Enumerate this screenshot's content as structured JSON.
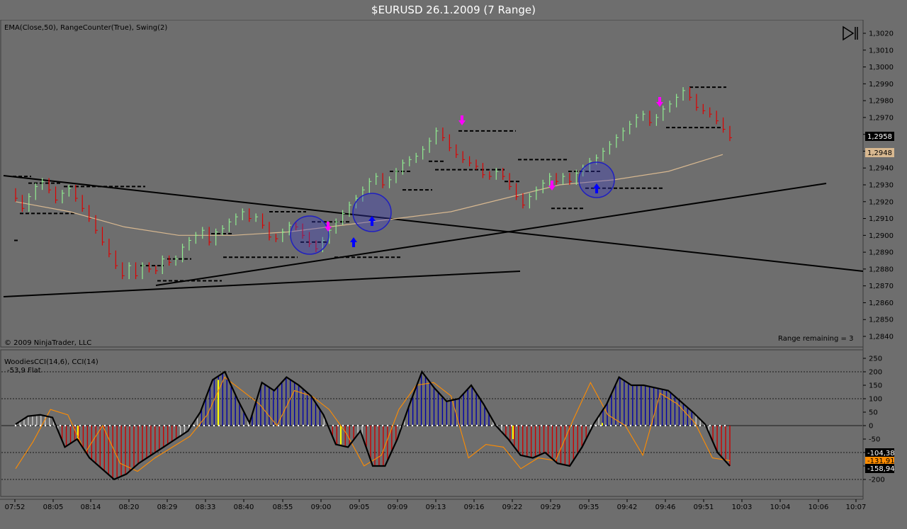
{
  "window": {
    "title": "$EURUSD  26.1.2009 (7 Range)"
  },
  "price_panel": {
    "indicators_label": "EMA(Close,50), RangeCounter(True), Swing(2)",
    "copyright": "© 2009 NinjaTrader, LLC",
    "range_remaining": "Range remaining = 3",
    "last_price_label": "1,2958",
    "ema_price_label": "1,2948"
  },
  "cci_panel": {
    "indicators_label": "WoodiesCCI(14,6), CCI(14)",
    "status_label": "-53,9 Flat",
    "cci_value_label": "-104,38",
    "turbo_value_label": "-131,91",
    "woodies_value_label": "-158,94"
  },
  "colors": {
    "background": "#6e6e6e",
    "up_bar": "#90ee90",
    "down_bar": "#dd0000",
    "ema": "#d8b890",
    "swing": "#000000",
    "cci_blue": "#0000aa",
    "cci_red": "#cc0000",
    "cci_neutral": "#c8c8c8",
    "cci_yellow": "#ffff00",
    "turbo_cci": "#ff8c00",
    "signal_up": "#0000ff",
    "signal_magenta": "#ff00ff"
  },
  "chart_data": [
    {
      "type": "line",
      "title": "$EURUSD  26.1.2009 (7 Range)",
      "ylim": [
        1.2835,
        1.3025
      ],
      "y_ticks": [
        "1,3020",
        "1,3010",
        "1,3000",
        "1,2990",
        "1,2980",
        "1,2970",
        "1,2960",
        "1,2950",
        "1,2940",
        "1,2930",
        "1,2920",
        "1,2910",
        "1,2900",
        "1,2890",
        "1,2880",
        "1,2870",
        "1,2860",
        "1,2850",
        "1,2840"
      ],
      "x_ticks": [
        "07:52",
        "08:05",
        "08:14",
        "08:20",
        "08:29",
        "08:33",
        "08:40",
        "08:55",
        "09:00",
        "09:05",
        "09:09",
        "09:13",
        "09:16",
        "09:22",
        "09:29",
        "09:35",
        "09:42",
        "09:46",
        "09:51",
        "10:03",
        "10:04",
        "10:06",
        "10:07"
      ],
      "grid": false,
      "series": [
        {
          "values": [
            1.2922,
            1.2916,
            1.2923,
            1.2929,
            1.2932,
            1.2927,
            1.2921,
            1.2925,
            1.2928,
            1.2922,
            1.2916,
            1.291,
            1.2903,
            1.2896,
            1.2889,
            1.2882,
            1.2876,
            1.2882,
            1.2876,
            1.2882,
            1.288,
            1.2879,
            1.2886,
            1.2884,
            1.2886,
            1.2893,
            1.2897,
            1.29,
            1.2903,
            1.2896,
            1.2902,
            1.2904,
            1.2908,
            1.2911,
            1.2914,
            1.291,
            1.2911,
            1.2906,
            1.2899,
            1.2898,
            1.2902,
            1.2906,
            1.2905,
            1.29,
            1.2895,
            1.2892,
            1.2897,
            1.2903,
            1.2908,
            1.2913,
            1.2918,
            1.2922,
            1.2927,
            1.2932,
            1.2935,
            1.293,
            1.2933,
            1.2938,
            1.2943,
            1.2945,
            1.2947,
            1.2951,
            1.2956,
            1.2962,
            1.2958,
            1.2952,
            1.2948,
            1.2945,
            1.2943,
            1.2941,
            1.2936,
            1.2935,
            1.2938,
            1.2935,
            1.2929,
            1.2923,
            1.2918,
            1.2923,
            1.2927,
            1.2931,
            1.2935,
            1.2932,
            1.2935,
            1.2932,
            1.2937,
            1.294,
            1.2944,
            1.2946,
            1.295,
            1.2954,
            1.2958,
            1.2962,
            1.2966,
            1.297,
            1.2972,
            1.2967,
            1.297,
            1.2975,
            1.2978,
            1.2982,
            1.2986,
            1.2982,
            1.2976,
            1.2974,
            1.2972,
            1.2968,
            1.2963,
            1.2958
          ]
        },
        {
          "name": "EMA(Close,50)",
          "values": [
            1.292,
            1.2914,
            1.2905,
            1.29,
            1.29,
            1.2902,
            1.2906,
            1.291,
            1.2914,
            1.2922,
            1.293,
            1.2933,
            1.2938,
            1.2948
          ]
        }
      ]
    },
    {
      "type": "bar",
      "title": "WoodiesCCI(14,6), CCI(14)",
      "ylim": [
        -250,
        250
      ],
      "y_ticks": [
        "250",
        "200",
        "150",
        "100",
        "50",
        "0",
        "-50",
        "-100",
        "-150",
        "-200"
      ],
      "series": [
        {
          "name": "CCI(14)",
          "values": [
            5,
            35,
            40,
            30,
            -80,
            -50,
            -120,
            -160,
            -200,
            -180,
            -140,
            -110,
            -80,
            -50,
            -20,
            50,
            170,
            200,
            100,
            10,
            160,
            130,
            180,
            150,
            110,
            40,
            -70,
            -80,
            -20,
            -150,
            -150,
            -50,
            80,
            200,
            140,
            90,
            100,
            150,
            80,
            0,
            -50,
            -110,
            -120,
            -100,
            -140,
            -150,
            -80,
            10,
            80,
            180,
            150,
            150,
            140,
            130,
            90,
            50,
            5,
            -100,
            -150
          ]
        },
        {
          "name": "Turbo CCI",
          "values": [
            -160,
            -60,
            60,
            40,
            -100,
            0,
            -140,
            -170,
            -120,
            -80,
            -40,
            40,
            180,
            130,
            80,
            0,
            130,
            110,
            60,
            -30,
            -150,
            -110,
            60,
            150,
            160,
            110,
            -120,
            -70,
            -80,
            -160,
            -120,
            -130,
            20,
            160,
            40,
            0,
            -110,
            120,
            80,
            10,
            -120,
            -130
          ]
        }
      ]
    }
  ]
}
